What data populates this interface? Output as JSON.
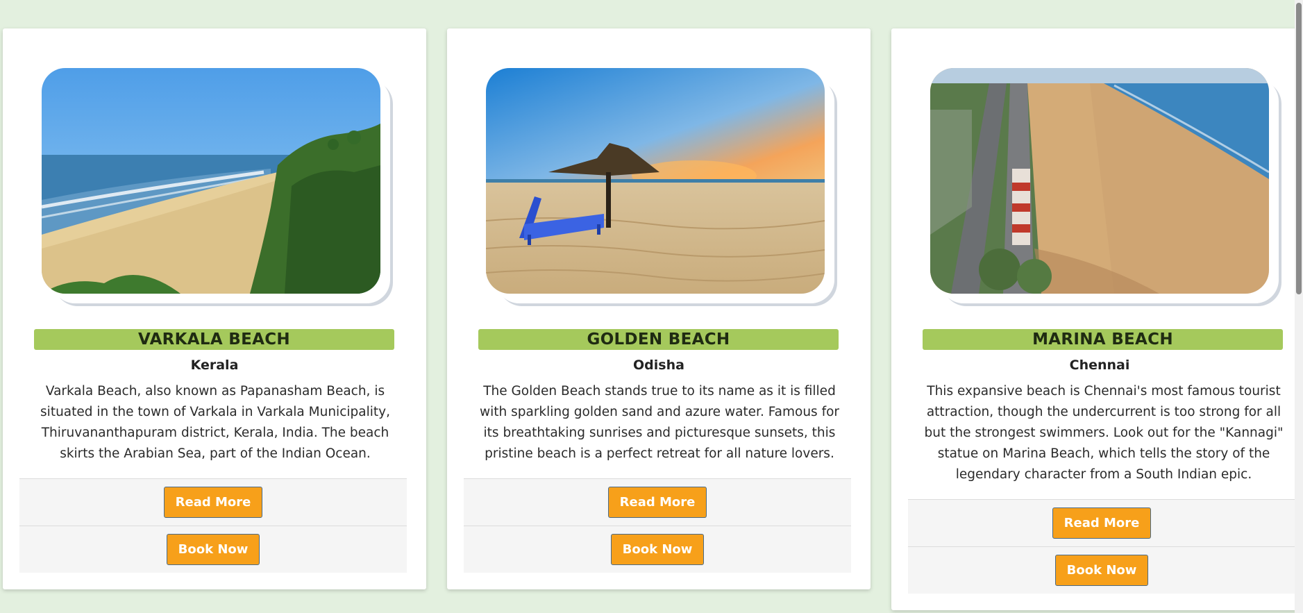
{
  "colors": {
    "background": "#e3f0df",
    "title_bar": "#a5c95c",
    "button": "#f7a01a",
    "button_text": "#ffffff"
  },
  "cards": [
    {
      "title": "VARKALA BEACH",
      "location": "Kerala",
      "description": "Varkala Beach, also known as Papanasham Beach, is situated in the town of Varkala in Varkala Municipality, Thiruvananthapuram district, Kerala, India. The beach skirts the Arabian Sea, part of the Indian Ocean.",
      "read_more_label": "Read More",
      "book_now_label": "Book Now"
    },
    {
      "title": "GOLDEN BEACH",
      "location": "Odisha",
      "description": "The Golden Beach stands true to its name as it is filled with sparkling golden sand and azure water. Famous for its breathtaking sunrises and picturesque sunsets, this pristine beach is a perfect retreat for all nature lovers.",
      "read_more_label": "Read More",
      "book_now_label": "Book Now"
    },
    {
      "title": "MARINA BEACH",
      "location": "Chennai",
      "description": "This expansive beach is Chennai's most famous tourist attraction, though the undercurrent is too strong for all but the strongest swimmers. Look out for the \"Kannagi\" statue on Marina Beach, which tells the story of the legendary character from a South Indian epic.",
      "read_more_label": "Read More",
      "book_now_label": "Book Now"
    }
  ]
}
